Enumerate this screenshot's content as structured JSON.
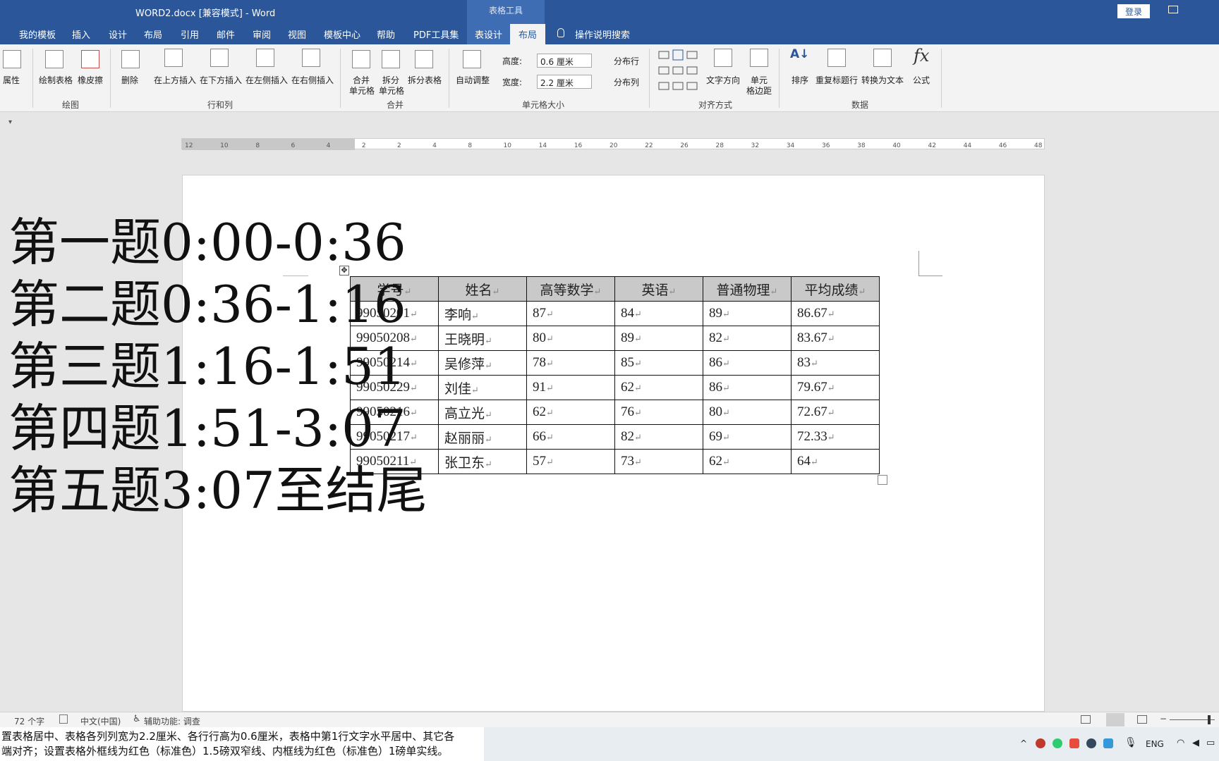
{
  "window": {
    "title": "WORD2.docx [兼容模式]  -  Word",
    "login": "登录",
    "context_tab_group": "表格工具"
  },
  "tabs": [
    "我的模板",
    "插入",
    "设计",
    "布局",
    "引用",
    "邮件",
    "审阅",
    "视图",
    "模板中心",
    "帮助",
    "PDF工具集",
    "表设计"
  ],
  "active_tab": "布局",
  "tell_me": "操作说明搜索",
  "ribbon": {
    "properties": "属性",
    "draw_table": "绘制表格",
    "eraser": "橡皮擦",
    "delete": "删除",
    "insert_above": "在上方插入",
    "insert_below": "在下方插入",
    "insert_left": "在左侧插入",
    "insert_right": "在右侧插入",
    "merge_cells_1": "合并",
    "merge_cells_2": "单元格",
    "split_cells_1": "拆分",
    "split_cells_2": "单元格",
    "split_table": "拆分表格",
    "autofit": "自动调整",
    "height_label": "高度:",
    "height_value": "0.6 厘米",
    "width_label": "宽度:",
    "width_value": "2.2 厘米",
    "distribute_rows": "分布行",
    "distribute_cols": "分布列",
    "text_direction": "文字方向",
    "cell_margins_1": "单元",
    "cell_margins_2": "格边距",
    "sort": "排序",
    "repeat_header": "重复标题行",
    "convert_text": "转换为文本",
    "formula": "公式",
    "groups": {
      "draw": "绘图",
      "rows_cols": "行和列",
      "merge": "合并",
      "cell_size": "单元格大小",
      "alignment": "对齐方式",
      "data": "数据"
    }
  },
  "ruler_marks": [
    "12",
    "10",
    "8",
    "6",
    "4",
    "2",
    "2",
    "4",
    "8",
    "10",
    "14",
    "16",
    "20",
    "22",
    "26",
    "28",
    "32",
    "34",
    "36",
    "38",
    "40",
    "42",
    "44",
    "46",
    "48"
  ],
  "overlay_lines": [
    "第一题0:00-0:36",
    "第二题0:36-1:16",
    "第三题1:16-1:51",
    "第四题1:51-3:07",
    "第五题3:07至结尾"
  ],
  "table": {
    "headers": [
      "学号",
      "姓名",
      "高等数学",
      "英语",
      "普通物理",
      "平均成绩"
    ],
    "rows": [
      [
        "99050201",
        "李响",
        "87",
        "84",
        "89",
        "86.67"
      ],
      [
        "99050208",
        "王晓明",
        "80",
        "89",
        "82",
        "83.67"
      ],
      [
        "99050214",
        "吴修萍",
        "78",
        "85",
        "86",
        "83"
      ],
      [
        "99050229",
        "刘佳",
        "91",
        "62",
        "86",
        "79.67"
      ],
      [
        "99050216",
        "高立光",
        "62",
        "76",
        "80",
        "72.67"
      ],
      [
        "99050217",
        "赵丽丽",
        "66",
        "82",
        "69",
        "72.33"
      ],
      [
        "99050211",
        "张卫东",
        "57",
        "73",
        "62",
        "64"
      ]
    ]
  },
  "status": {
    "word_count": "72 个字",
    "language": "中文(中国)",
    "accessibility": "辅助功能: 调查"
  },
  "task_text": {
    "line1": "置表格居中、表格各列列宽为2.2厘米、各行行高为0.6厘米，表格中第1行文字水平居中、其它各",
    "line2": "端对齐；设置表格外框线为红色（标准色）1.5磅双窄线、内框线为红色（标准色）1磅单实线。"
  },
  "tray": {
    "lang": "ENG"
  },
  "colors": {
    "accent": "#2b579a",
    "header_fill": "#c9c9c9"
  }
}
